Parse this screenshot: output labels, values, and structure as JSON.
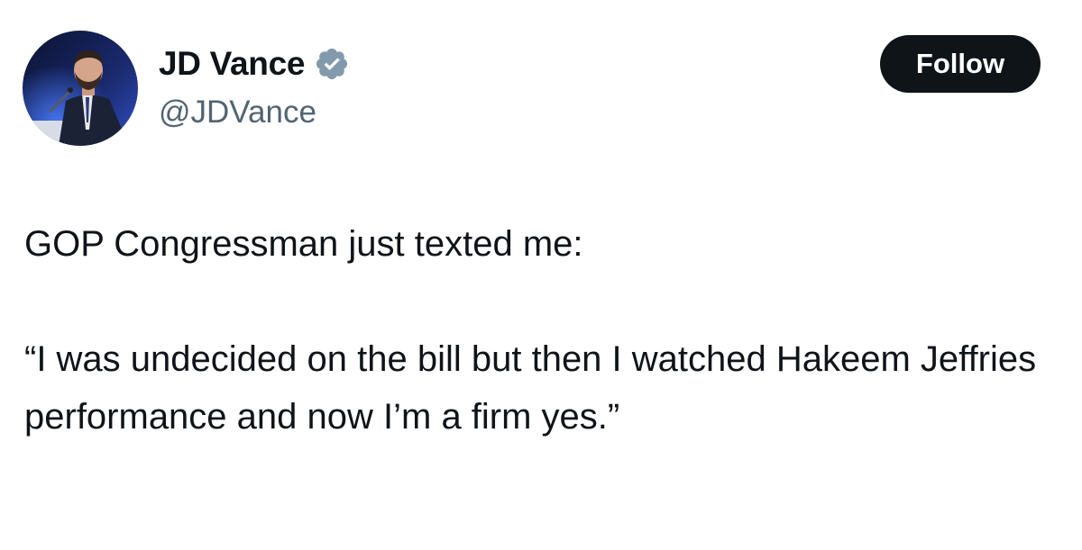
{
  "author": {
    "display_name": "JD Vance",
    "handle": "@JDVance",
    "verified_icon": "verified-badge-icon",
    "verified_color": "#829aab"
  },
  "actions": {
    "follow_label": "Follow"
  },
  "tweet": {
    "line_1": "GOP Congressman just texted me:",
    "line_2": "“I was undecided on the bill but then I watched Hakeem Jeffries performance and now I’m a firm yes.”"
  },
  "colors": {
    "text_primary": "#0f1419",
    "text_secondary": "#536471",
    "button_bg": "#0f1419",
    "button_text": "#ffffff"
  }
}
